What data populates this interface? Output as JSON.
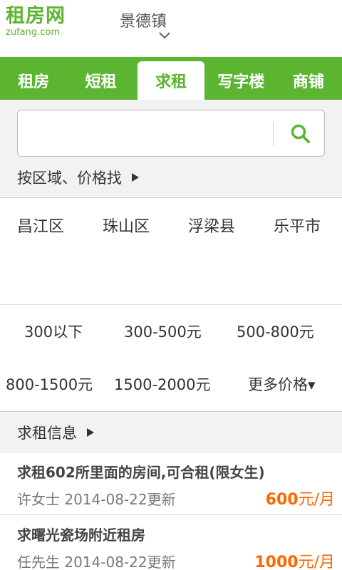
{
  "header": {
    "logo_cn": "租房网",
    "logo_en": "zufang.com",
    "city": "景德镇"
  },
  "tabs": [
    {
      "label": "租房",
      "active": false
    },
    {
      "label": "短租",
      "active": false
    },
    {
      "label": "求租",
      "active": true
    },
    {
      "label": "写字楼",
      "active": false
    },
    {
      "label": "商铺",
      "active": false
    }
  ],
  "search": {
    "placeholder": "",
    "value": "",
    "area_price_link": "按区域、价格找"
  },
  "districts": [
    "昌江区",
    "珠山区",
    "浮梁县",
    "乐平市"
  ],
  "prices": [
    "300以下",
    "300-500元",
    "500-800元",
    "800-1500元",
    "1500-2000元",
    "更多价格▾"
  ],
  "info": {
    "title": "求租信息"
  },
  "listings": [
    {
      "title": "求租602所里面的房间,可合租(限女生)",
      "meta": "许女士  2014-08-22更新",
      "price": "600",
      "unit": "元/月"
    },
    {
      "title": "求曙光瓷场附近租房",
      "meta": "任先生  2014-08-22更新",
      "price": "1000",
      "unit": "元/月"
    }
  ],
  "colors": {
    "brand_green": "#5cb531",
    "price_orange": "#ff6600"
  }
}
